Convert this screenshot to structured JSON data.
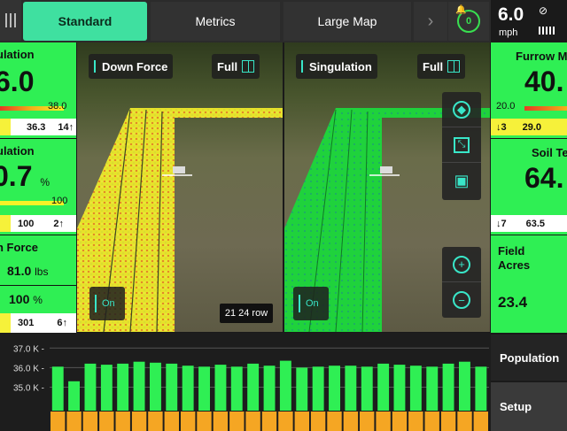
{
  "header": {
    "tabs": [
      {
        "label": "Standard",
        "active": true
      },
      {
        "label": "Metrics",
        "active": false
      },
      {
        "label": "Large Map",
        "active": false
      }
    ],
    "notifications": "0",
    "speed": {
      "value": "6.0",
      "unit": "mph"
    }
  },
  "left_widgets": {
    "population": {
      "title": "ulation",
      "value": "6.0",
      "gauge_max": "38.0",
      "avg": "36.3",
      "count": "14",
      "arrow": "↑"
    },
    "singulation": {
      "title": "ulation",
      "value": "0.7",
      "unit": "%",
      "gauge_max": "100",
      "avg": "100",
      "count": "2",
      "arrow": "↑"
    },
    "downforce": {
      "title": "n Force",
      "value": "81.0",
      "unit": "lbs",
      "margin": "100",
      "margin_unit": "%",
      "avg": "301",
      "count": "6",
      "arrow": "↑"
    }
  },
  "maps": {
    "left": {
      "layer": "Down Force",
      "view": "Full",
      "toggle": "On",
      "row_label": "21 24 row"
    },
    "right": {
      "layer": "Singulation",
      "view": "Full",
      "toggle": "On"
    }
  },
  "map_controls": {
    "icons": [
      "compass-icon",
      "expand-icon",
      "tractor-icon"
    ],
    "zoom": [
      "zoom-in-icon",
      "zoom-out-icon"
    ]
  },
  "right_widgets": {
    "furrow": {
      "title": "Furrow M",
      "value": "40.",
      "low": "20.0",
      "count": "3",
      "arrow": "↓",
      "avg": "29.0"
    },
    "soil": {
      "title": "Soil Te",
      "value": "64.",
      "count": "7",
      "arrow": "↓",
      "avg": "63.5"
    },
    "field": {
      "title_line1": "Field",
      "title_line2": "Acres",
      "value": "23.4"
    }
  },
  "side_buttons": {
    "population": "Population",
    "setup": "Setup"
  },
  "colors": {
    "widget_green": "#2fef54",
    "active_tab": "#3fe0a0",
    "accent_teal": "#39e6c8",
    "bar_orange": "#f5a623"
  },
  "chart_data": {
    "type": "bar",
    "ytick_labels": [
      "37.0 K",
      "36.0 K",
      "35.0 K"
    ],
    "yticks": [
      37000,
      36000,
      35000
    ],
    "ylim": [
      33800,
      37600
    ],
    "values": [
      36050,
      35300,
      36200,
      36150,
      36200,
      36300,
      36250,
      36200,
      36100,
      36050,
      36150,
      36050,
      36200,
      36100,
      36350,
      36000,
      36050,
      36100,
      36100,
      36050,
      36200,
      36150,
      36100,
      36050,
      36200,
      36300,
      36050
    ]
  }
}
